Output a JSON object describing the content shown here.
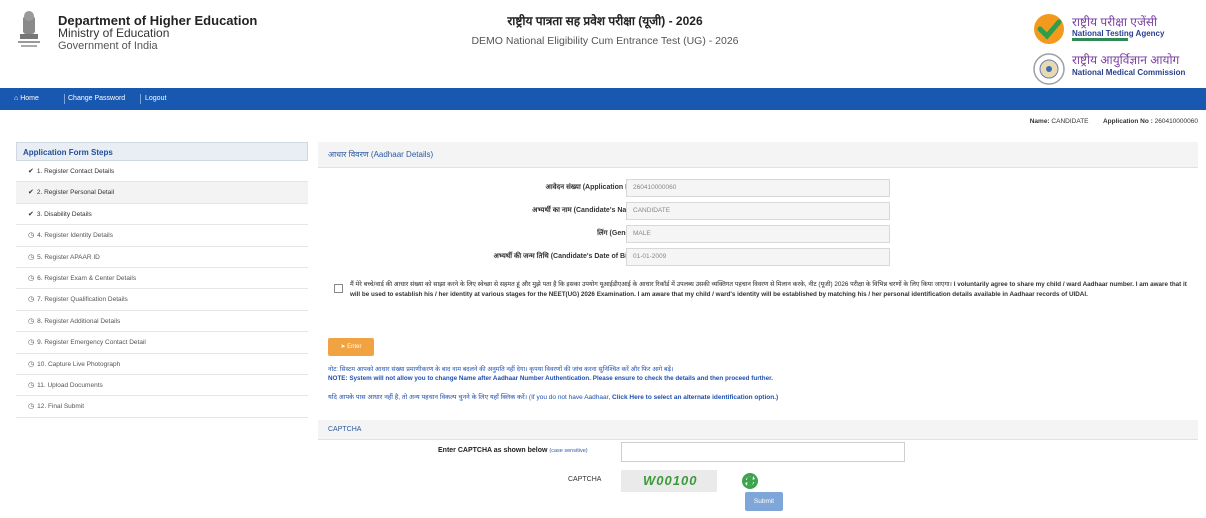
{
  "header": {
    "dept_line1": "Department of Higher Education",
    "dept_line2": "Ministry of Education",
    "dept_line3": "Government of India",
    "title_hindi": "राष्ट्रीय पात्रता सह प्रवेश परीक्षा (यूजी) - 2026",
    "subtitle": "DEMO National Eligibility Cum Entrance Test (UG) - 2026",
    "nta_hindi": "राष्ट्रीय परीक्षा एजेंसी",
    "nta_english": "National Testing Agency",
    "nmc_hindi": "राष्ट्रीय आयुर्विज्ञान आयोग",
    "nmc_english": "National Medical Commission"
  },
  "nav": {
    "home": "Home",
    "change_password": "Change Password",
    "logout": "Logout"
  },
  "candidate": {
    "name_label": "Name:",
    "name_value": "CANDIDATE",
    "app_label": "Application No :",
    "app_value": "260410000060"
  },
  "sidebar": {
    "heading": "Application Form Steps",
    "items": [
      {
        "label": "1. Register Contact Details",
        "done": true
      },
      {
        "label": "2. Register Personal Detail",
        "done": true
      },
      {
        "label": "3. Disability Details",
        "done": true
      },
      {
        "label": "4. Register Identity Details",
        "done": false
      },
      {
        "label": "5. Register APAAR ID",
        "done": false
      },
      {
        "label": "6. Register Exam & Center Details",
        "done": false
      },
      {
        "label": "7. Register Qualification Details",
        "done": false
      },
      {
        "label": "8. Register Additional Details",
        "done": false
      },
      {
        "label": "9. Register Emergency Contact Detail",
        "done": false
      },
      {
        "label": "10. Capture Live Photograph",
        "done": false
      },
      {
        "label": "11. Upload Documents",
        "done": false
      },
      {
        "label": "12. Final Submit",
        "done": false
      }
    ]
  },
  "aadhaar": {
    "heading": "आधार विवरण (Aadhaar Details)",
    "fields": [
      {
        "label": "आवेदन संख्या (Application No.) :",
        "value": "260410000060"
      },
      {
        "label": "अभ्यर्थी का नाम (Candidate's Name) :",
        "value": "CANDIDATE"
      },
      {
        "label": "लिंग (Gender) :",
        "value": "MALE"
      },
      {
        "label": "अभ्यर्थी की जन्म तिथि (Candidate's Date of Birth) :",
        "value": "01-01-2009"
      }
    ],
    "consent_hindi": "मैं मेरे बच्चे/वार्ड की आधार संख्या को साझा करने के लिए स्वेच्छा से सहमत हूं और मुझे पता है कि इसका उपयोग यूआईडीएआई के आधार रिकॉर्ड में उपलब्ध उसकी व्यक्तिगत पहचान विवरण से मिलान करके, नीट (यूजी) 2026 परीक्षा के विभिन्न चरणों के लिए किया जाएगा।",
    "consent_english": " I voluntarily agree to share my child / ward Aadhaar number. I am aware that it will be used to establish his / her identity at various stages for the NEET(UG) 2026 Examination. I am aware that my child / ward's identity will be established by matching his / her personal identification details available in Aadhaar records of UIDAI.",
    "button": "Enter",
    "note_hindi": "नोट: सिस्टम आपको आधार संख्या प्रमाणीकरण के बाद नाम बदलने की अनुमति नहीं देगा। कृपया विवरणों की जांच करना सुनिश्चित करें और फिर आगे बढ़ें।",
    "note_english": "NOTE: System will not allow you to change Name after Aadhaar Number Authentication. Please ensure to check the details and then proceed further.",
    "alt_prefix": "यदि आपके पास आधार नहीं है, तो अन्य पहचान विकल्प चुनने के लिए यहाँ क्लिक करें। (If you do not have Aadhaar, ",
    "alt_link": "Click Here to select an alternate identification option.)"
  },
  "captcha": {
    "heading": "CAPTCHA",
    "prompt": "Enter CAPTCHA as shown below",
    "case_note": "(case sensitive)",
    "label": "CAPTCHA",
    "code": "W00100",
    "submit": "Submit"
  }
}
